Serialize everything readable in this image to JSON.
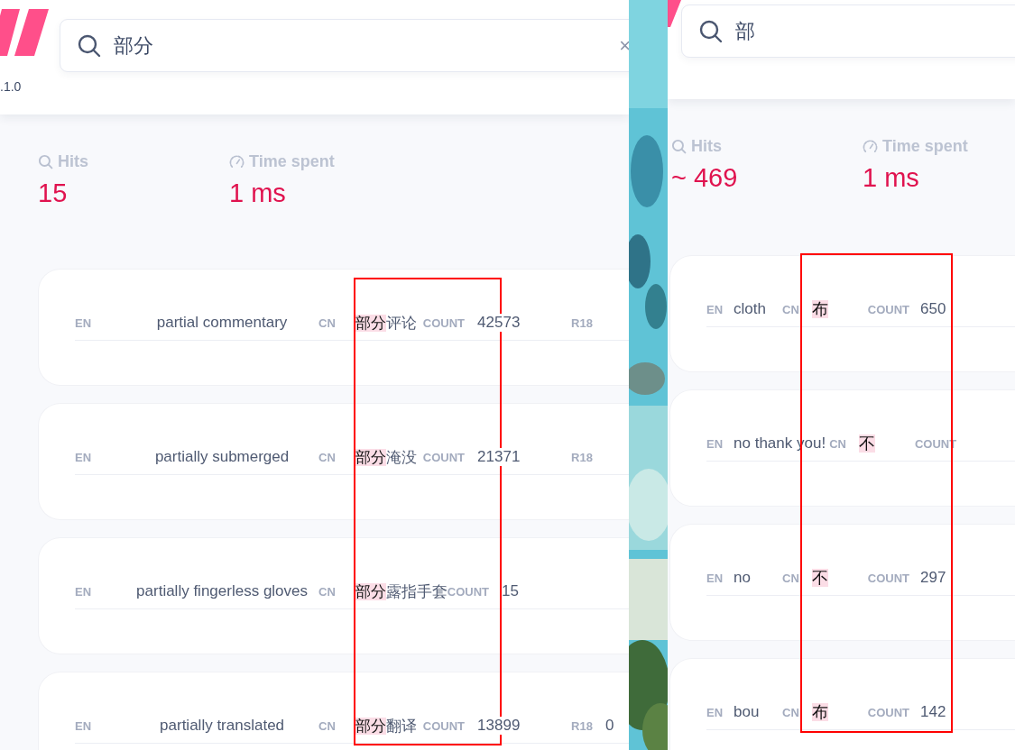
{
  "panels": [
    {
      "kind": "wide",
      "version": ".1.0",
      "search": {
        "value": "部分",
        "clear": "×"
      },
      "frame": true,
      "stats": [
        {
          "kind": "hits",
          "label": "Hits",
          "value": "15"
        },
        {
          "kind": "time",
          "label": "Time spent",
          "value": "1 ms"
        }
      ],
      "results": [
        {
          "cells": [
            {
              "kind": "label",
              "text": "EN"
            },
            {
              "kind": "en",
              "text": "partial commentary"
            },
            {
              "kind": "label",
              "text": "CN"
            },
            {
              "kind": "cn",
              "parts": [
                {
                  "text": "部分",
                  "match": true
                },
                {
                  "text": "评论",
                  "match": false
                }
              ]
            },
            {
              "kind": "label",
              "text": "COUNT"
            },
            {
              "kind": "count",
              "text": "42573"
            },
            {
              "kind": "tag",
              "text": "R18"
            }
          ]
        },
        {
          "cells": [
            {
              "kind": "label",
              "text": "EN"
            },
            {
              "kind": "en",
              "text": "partially submerged"
            },
            {
              "kind": "label",
              "text": "CN"
            },
            {
              "kind": "cn",
              "parts": [
                {
                  "text": "部分",
                  "match": true
                },
                {
                  "text": "淹没",
                  "match": false
                }
              ]
            },
            {
              "kind": "label",
              "text": "COUNT"
            },
            {
              "kind": "count",
              "text": "21371"
            },
            {
              "kind": "tag",
              "text": "R18"
            }
          ]
        },
        {
          "cells": [
            {
              "kind": "label",
              "text": "EN"
            },
            {
              "kind": "en",
              "text": "partially fingerless gloves"
            },
            {
              "kind": "label",
              "text": "CN"
            },
            {
              "kind": "cn",
              "parts": [
                {
                  "text": "部分",
                  "match": true
                },
                {
                  "text": "露指手套",
                  "match": false
                }
              ]
            },
            {
              "kind": "label",
              "text": "COUNT"
            },
            {
              "kind": "count",
              "text": "15"
            }
          ]
        },
        {
          "cells": [
            {
              "kind": "label",
              "text": "EN"
            },
            {
              "kind": "en",
              "text": "partially translated"
            },
            {
              "kind": "label",
              "text": "CN"
            },
            {
              "kind": "cn",
              "parts": [
                {
                  "text": "部分",
                  "match": true
                },
                {
                  "text": "翻译",
                  "match": false
                }
              ]
            },
            {
              "kind": "label",
              "text": "COUNT"
            },
            {
              "kind": "count",
              "text": "13899"
            },
            {
              "kind": "tag",
              "text": "R18"
            },
            {
              "kind": "count",
              "text": "0"
            }
          ]
        }
      ]
    },
    {
      "kind": "narrow",
      "search": {
        "value": "部"
      },
      "frame": true,
      "stats": [
        {
          "kind": "hits",
          "label": "Hits",
          "value": "~ 469"
        },
        {
          "kind": "time",
          "label": "Time spent",
          "value": "1 ms"
        }
      ],
      "results": [
        {
          "cells": [
            {
              "kind": "label",
              "text": "EN"
            },
            {
              "kind": "en",
              "text": "cloth"
            },
            {
              "kind": "label",
              "text": "CN"
            },
            {
              "kind": "cn",
              "parts": [
                {
                  "text": "布",
                  "match": true
                }
              ]
            },
            {
              "kind": "label",
              "text": "COUNT"
            },
            {
              "kind": "count",
              "text": "650"
            }
          ]
        },
        {
          "cells": [
            {
              "kind": "label",
              "text": "EN"
            },
            {
              "kind": "en",
              "text": "no thank you!"
            },
            {
              "kind": "label",
              "text": "CN"
            },
            {
              "kind": "cn",
              "parts": [
                {
                  "text": "不",
                  "match": true
                }
              ]
            },
            {
              "kind": "label",
              "text": "COUNT"
            }
          ]
        },
        {
          "cells": [
            {
              "kind": "label",
              "text": "EN"
            },
            {
              "kind": "en",
              "text": "no"
            },
            {
              "kind": "label",
              "text": "CN"
            },
            {
              "kind": "cn",
              "parts": [
                {
                  "text": "不",
                  "match": true
                }
              ]
            },
            {
              "kind": "label",
              "text": "COUNT"
            },
            {
              "kind": "count",
              "text": "297"
            }
          ]
        },
        {
          "cells": [
            {
              "kind": "label",
              "text": "EN"
            },
            {
              "kind": "en",
              "text": "bou"
            },
            {
              "kind": "label",
              "text": "CN"
            },
            {
              "kind": "cn",
              "parts": [
                {
                  "text": "布",
                  "match": true
                }
              ]
            },
            {
              "kind": "label",
              "text": "COUNT"
            },
            {
              "kind": "count",
              "text": "142"
            }
          ]
        }
      ]
    }
  ]
}
